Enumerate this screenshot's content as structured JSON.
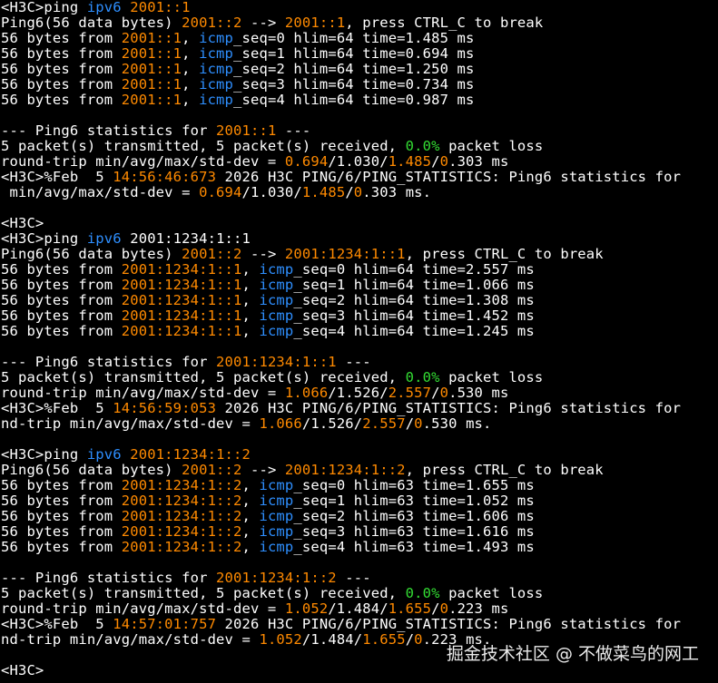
{
  "terminal": {
    "colors": {
      "w": "#ffffff",
      "o": "#ff8a00",
      "b": "#2e8fff",
      "g": "#33dd33"
    },
    "lines": [
      [
        [
          "w",
          "<H3C>ping "
        ],
        [
          "b",
          "ipv6"
        ],
        [
          "w",
          " "
        ],
        [
          "o",
          "2001::1"
        ]
      ],
      [
        [
          "w",
          "Ping6(56 data bytes) "
        ],
        [
          "o",
          "2001::2"
        ],
        [
          "w",
          " --> "
        ],
        [
          "o",
          "2001::1"
        ],
        [
          "w",
          ", press CTRL_C to break"
        ]
      ],
      [
        [
          "w",
          "56 bytes from "
        ],
        [
          "o",
          "2001::1"
        ],
        [
          "w",
          ", "
        ],
        [
          "b",
          "icmp"
        ],
        [
          "w",
          "_seq=0 hlim=64 time=1.485 ms"
        ]
      ],
      [
        [
          "w",
          "56 bytes from "
        ],
        [
          "o",
          "2001::1"
        ],
        [
          "w",
          ", "
        ],
        [
          "b",
          "icmp"
        ],
        [
          "w",
          "_seq=1 hlim=64 time=0.694 ms"
        ]
      ],
      [
        [
          "w",
          "56 bytes from "
        ],
        [
          "o",
          "2001::1"
        ],
        [
          "w",
          ", "
        ],
        [
          "b",
          "icmp"
        ],
        [
          "w",
          "_seq=2 hlim=64 time=1.250 ms"
        ]
      ],
      [
        [
          "w",
          "56 bytes from "
        ],
        [
          "o",
          "2001::1"
        ],
        [
          "w",
          ", "
        ],
        [
          "b",
          "icmp"
        ],
        [
          "w",
          "_seq=3 hlim=64 time=0.734 ms"
        ]
      ],
      [
        [
          "w",
          "56 bytes from "
        ],
        [
          "o",
          "2001::1"
        ],
        [
          "w",
          ", "
        ],
        [
          "b",
          "icmp"
        ],
        [
          "w",
          "_seq=4 hlim=64 time=0.987 ms"
        ]
      ],
      [],
      [
        [
          "w",
          "--- Ping6 statistics for "
        ],
        [
          "o",
          "2001::1"
        ],
        [
          "w",
          " ---"
        ]
      ],
      [
        [
          "w",
          "5 packet(s) transmitted, 5 packet(s) received, "
        ],
        [
          "g",
          "0.0%"
        ],
        [
          "w",
          " packet loss"
        ]
      ],
      [
        [
          "w",
          "round-trip min/avg/max/std-dev = "
        ],
        [
          "o",
          "0.694"
        ],
        [
          "w",
          "/1.030/"
        ],
        [
          "o",
          "1.485"
        ],
        [
          "w",
          "/"
        ],
        [
          "o",
          "0"
        ],
        [
          "w",
          ".303 ms"
        ]
      ],
      [
        [
          "w",
          "<H3C>%Feb  5 "
        ],
        [
          "o",
          "14:56:46:673"
        ],
        [
          "w",
          " 2026 H3C PING/6/PING_STATISTICS: Ping6 statistics for"
        ]
      ],
      [
        [
          "w",
          " min/avg/max/std-dev = "
        ],
        [
          "o",
          "0.694"
        ],
        [
          "w",
          "/1.030/"
        ],
        [
          "o",
          "1.485"
        ],
        [
          "w",
          "/"
        ],
        [
          "o",
          "0"
        ],
        [
          "w",
          ".303 ms."
        ]
      ],
      [],
      [
        [
          "w",
          "<H3C>"
        ]
      ],
      [
        [
          "w",
          "<H3C>ping "
        ],
        [
          "b",
          "ipv6"
        ],
        [
          "w",
          " 2001:1234:1::1"
        ]
      ],
      [
        [
          "w",
          "Ping6(56 data bytes) "
        ],
        [
          "o",
          "2001::2"
        ],
        [
          "w",
          " --> "
        ],
        [
          "o",
          "2001:1234:1::1"
        ],
        [
          "w",
          ", press CTRL_C to break"
        ]
      ],
      [
        [
          "w",
          "56 bytes from "
        ],
        [
          "o",
          "2001:1234:1::1"
        ],
        [
          "w",
          ", "
        ],
        [
          "b",
          "icmp"
        ],
        [
          "w",
          "_seq=0 hlim=64 time=2.557 ms"
        ]
      ],
      [
        [
          "w",
          "56 bytes from "
        ],
        [
          "o",
          "2001:1234:1::1"
        ],
        [
          "w",
          ", "
        ],
        [
          "b",
          "icmp"
        ],
        [
          "w",
          "_seq=1 hlim=64 time=1.066 ms"
        ]
      ],
      [
        [
          "w",
          "56 bytes from "
        ],
        [
          "o",
          "2001:1234:1::1"
        ],
        [
          "w",
          ", "
        ],
        [
          "b",
          "icmp"
        ],
        [
          "w",
          "_seq=2 hlim=64 time=1.308 ms"
        ]
      ],
      [
        [
          "w",
          "56 bytes from "
        ],
        [
          "o",
          "2001:1234:1::1"
        ],
        [
          "w",
          ", "
        ],
        [
          "b",
          "icmp"
        ],
        [
          "w",
          "_seq=3 hlim=64 time=1.452 ms"
        ]
      ],
      [
        [
          "w",
          "56 bytes from "
        ],
        [
          "o",
          "2001:1234:1::1"
        ],
        [
          "w",
          ", "
        ],
        [
          "b",
          "icmp"
        ],
        [
          "w",
          "_seq=4 hlim=64 time=1.245 ms"
        ]
      ],
      [],
      [
        [
          "w",
          "--- Ping6 statistics for "
        ],
        [
          "o",
          "2001:1234:1::1"
        ],
        [
          "w",
          " ---"
        ]
      ],
      [
        [
          "w",
          "5 packet(s) transmitted, 5 packet(s) received, "
        ],
        [
          "g",
          "0.0%"
        ],
        [
          "w",
          " packet loss"
        ]
      ],
      [
        [
          "w",
          "round-trip min/avg/max/std-dev = "
        ],
        [
          "o",
          "1.066"
        ],
        [
          "w",
          "/1.526/"
        ],
        [
          "o",
          "2.557"
        ],
        [
          "w",
          "/"
        ],
        [
          "o",
          "0"
        ],
        [
          "w",
          ".530 ms"
        ]
      ],
      [
        [
          "w",
          "<H3C>%Feb  5 "
        ],
        [
          "o",
          "14:56:59:053"
        ],
        [
          "w",
          " 2026 H3C PING/6/PING_STATISTICS: Ping6 statistics for"
        ]
      ],
      [
        [
          "w",
          "nd-trip min/avg/max/std-dev = "
        ],
        [
          "o",
          "1.066"
        ],
        [
          "w",
          "/1.526/"
        ],
        [
          "o",
          "2.557"
        ],
        [
          "w",
          "/"
        ],
        [
          "o",
          "0"
        ],
        [
          "w",
          ".530 ms."
        ]
      ],
      [],
      [
        [
          "w",
          "<H3C>ping "
        ],
        [
          "b",
          "ipv6"
        ],
        [
          "w",
          " "
        ],
        [
          "o",
          "2001:1234:1::2"
        ]
      ],
      [
        [
          "w",
          "Ping6(56 data bytes) "
        ],
        [
          "o",
          "2001::2"
        ],
        [
          "w",
          " --> "
        ],
        [
          "o",
          "2001:1234:1::2"
        ],
        [
          "w",
          ", press CTRL_C to break"
        ]
      ],
      [
        [
          "w",
          "56 bytes from "
        ],
        [
          "o",
          "2001:1234:1::2"
        ],
        [
          "w",
          ", "
        ],
        [
          "b",
          "icmp"
        ],
        [
          "w",
          "_seq=0 hlim=63 time=1.655 ms"
        ]
      ],
      [
        [
          "w",
          "56 bytes from "
        ],
        [
          "o",
          "2001:1234:1::2"
        ],
        [
          "w",
          ", "
        ],
        [
          "b",
          "icmp"
        ],
        [
          "w",
          "_seq=1 hlim=63 time=1.052 ms"
        ]
      ],
      [
        [
          "w",
          "56 bytes from "
        ],
        [
          "o",
          "2001:1234:1::2"
        ],
        [
          "w",
          ", "
        ],
        [
          "b",
          "icmp"
        ],
        [
          "w",
          "_seq=2 hlim=63 time=1.606 ms"
        ]
      ],
      [
        [
          "w",
          "56 bytes from "
        ],
        [
          "o",
          "2001:1234:1::2"
        ],
        [
          "w",
          ", "
        ],
        [
          "b",
          "icmp"
        ],
        [
          "w",
          "_seq=3 hlim=63 time=1.616 ms"
        ]
      ],
      [
        [
          "w",
          "56 bytes from "
        ],
        [
          "o",
          "2001:1234:1::2"
        ],
        [
          "w",
          ", "
        ],
        [
          "b",
          "icmp"
        ],
        [
          "w",
          "_seq=4 hlim=63 time=1.493 ms"
        ]
      ],
      [],
      [
        [
          "w",
          "--- Ping6 statistics for "
        ],
        [
          "o",
          "2001:1234:1::2"
        ],
        [
          "w",
          " ---"
        ]
      ],
      [
        [
          "w",
          "5 packet(s) transmitted, 5 packet(s) received, "
        ],
        [
          "g",
          "0.0%"
        ],
        [
          "w",
          " packet loss"
        ]
      ],
      [
        [
          "w",
          "round-trip min/avg/max/std-dev = "
        ],
        [
          "o",
          "1.052"
        ],
        [
          "w",
          "/1.484/"
        ],
        [
          "o",
          "1.655"
        ],
        [
          "w",
          "/"
        ],
        [
          "o",
          "0"
        ],
        [
          "w",
          ".223 ms"
        ]
      ],
      [
        [
          "w",
          "<H3C>%Feb  5 "
        ],
        [
          "o",
          "14:57:01:757"
        ],
        [
          "w",
          " 2026 H3C PING/6/PING_STATISTICS: Ping6 statistics for"
        ]
      ],
      [
        [
          "w",
          "nd-trip min/avg/max/std-dev = "
        ],
        [
          "o",
          "1.052"
        ],
        [
          "w",
          "/1.484/"
        ],
        [
          "o",
          "1.655"
        ],
        [
          "w",
          "/"
        ],
        [
          "o",
          "0"
        ],
        [
          "w",
          ".223 ms."
        ]
      ],
      [],
      [
        [
          "w",
          "<H3C>"
        ]
      ]
    ]
  },
  "watermark": {
    "text": "掘金技术社区 @ 不做菜鸟的网工"
  }
}
